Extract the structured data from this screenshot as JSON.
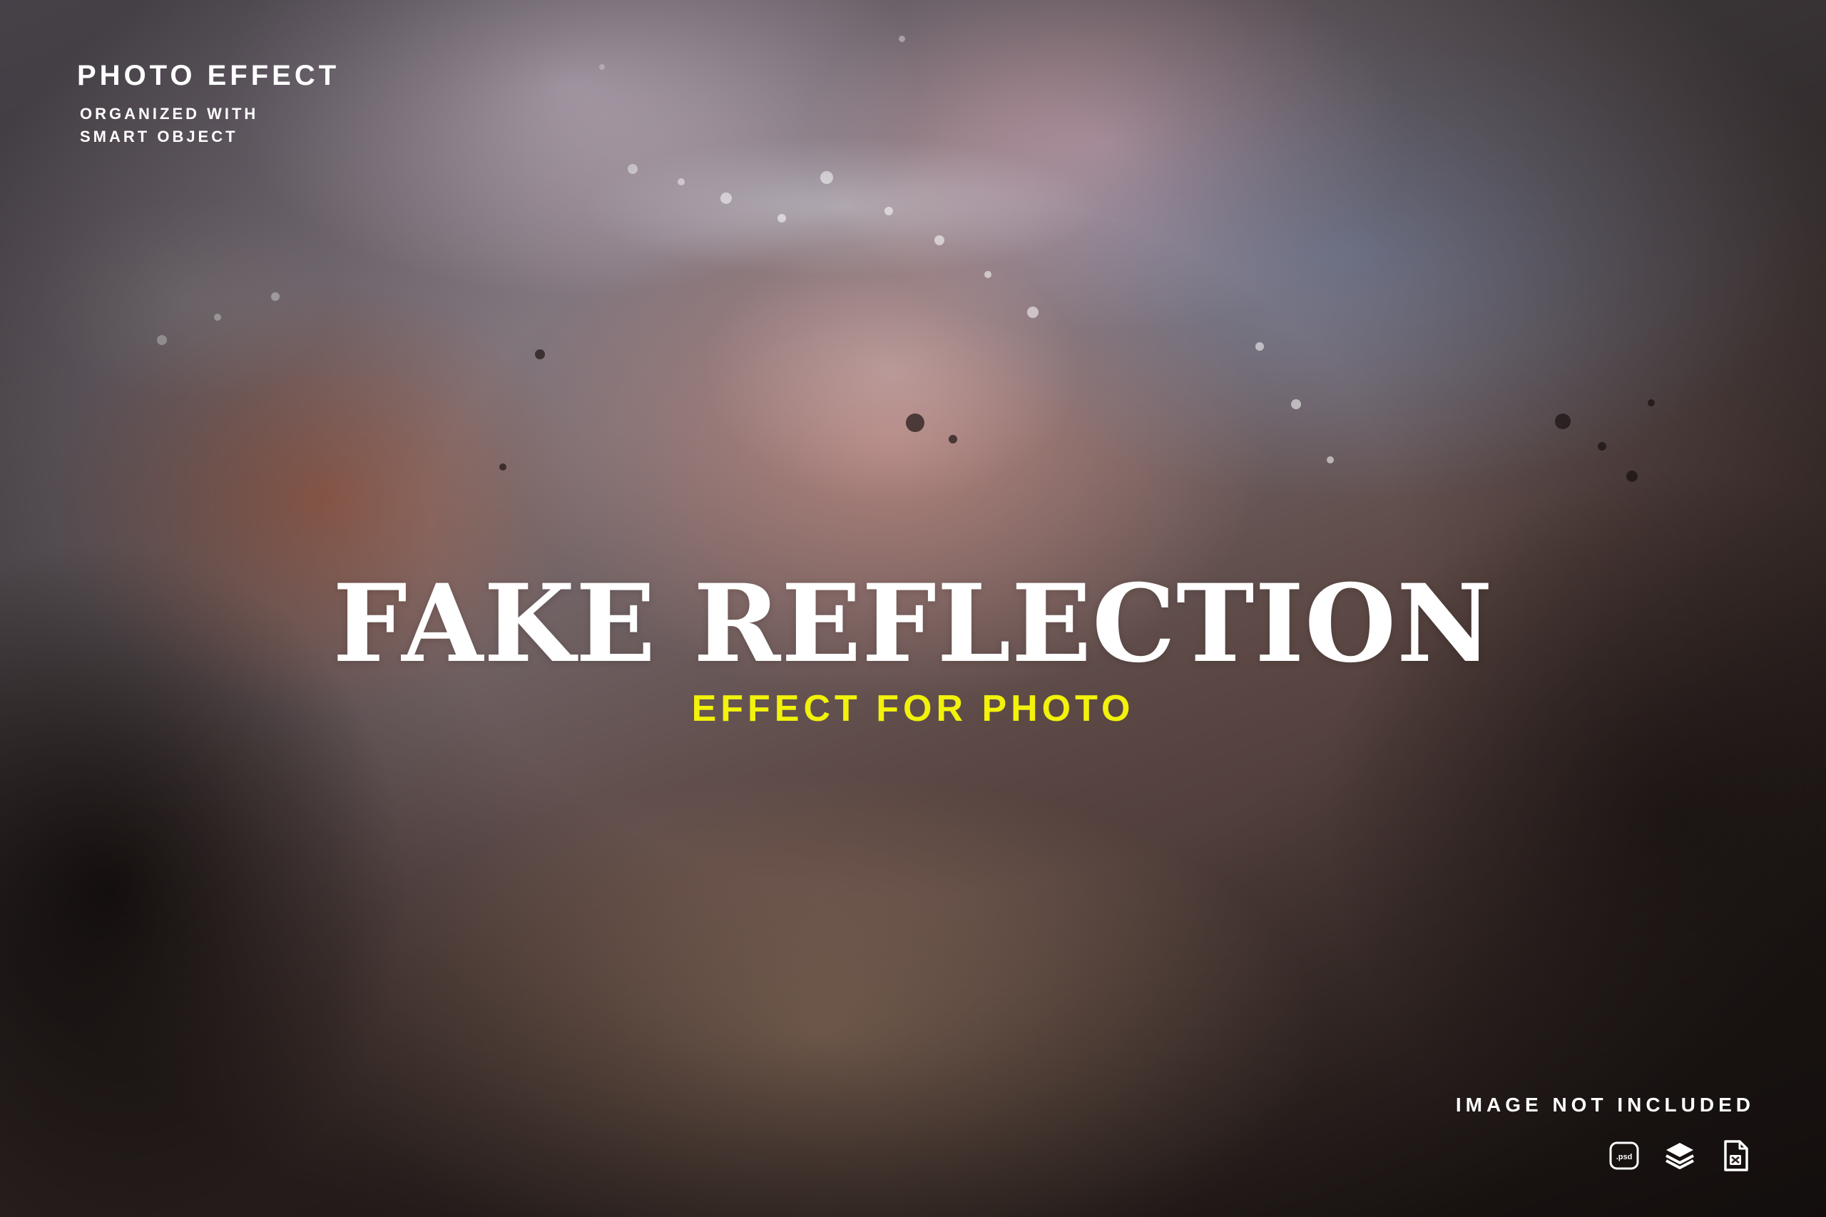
{
  "header": {
    "title": "PHOTO EFFECT",
    "subtitle_line1": "ORGANIZED WITH",
    "subtitle_line2": "SMART OBJECT"
  },
  "hero": {
    "title": "FAKE REFLECTION",
    "subtitle": "EFFECT FOR PHOTO"
  },
  "footer": {
    "notice": "IMAGE NOT INCLUDED",
    "icons": [
      {
        "name": "psd-file-icon",
        "label": ".psd"
      },
      {
        "name": "layers-icon"
      },
      {
        "name": "document-icon"
      }
    ]
  },
  "colors": {
    "title": "#ffffff",
    "accent": "#f2f20a"
  }
}
